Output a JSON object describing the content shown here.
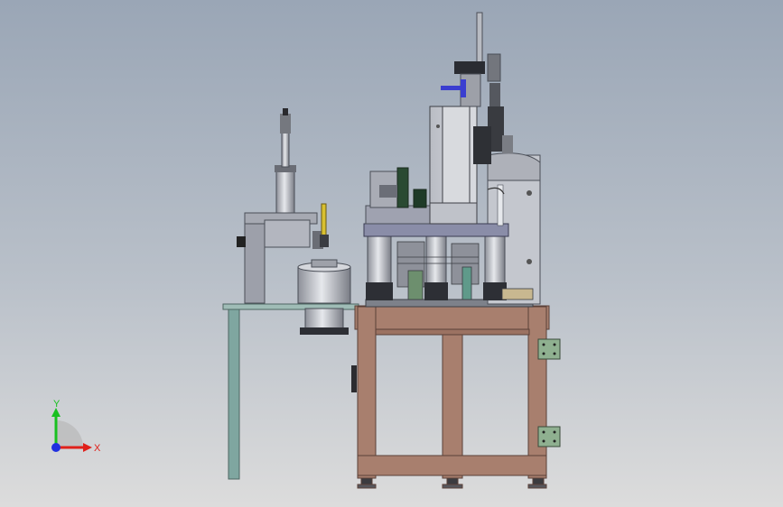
{
  "axes": {
    "x_label": "X",
    "y_label": "Y",
    "x_color": "#e0201a",
    "y_color": "#18c020",
    "z_color": "#2030e0"
  },
  "colors": {
    "background_top": "#9aa6b6",
    "background_bottom": "#dcdcdc",
    "frame_wood": "#a87f6e",
    "frame_edge": "#5a4038",
    "table_leg": "#7fa6a0",
    "machine_grey": "#c9ccd3",
    "machine_dark": "#4a4e57",
    "accent_blue": "#3a3ed0",
    "accent_yellow": "#d8c030",
    "accent_green": "#40a060"
  }
}
